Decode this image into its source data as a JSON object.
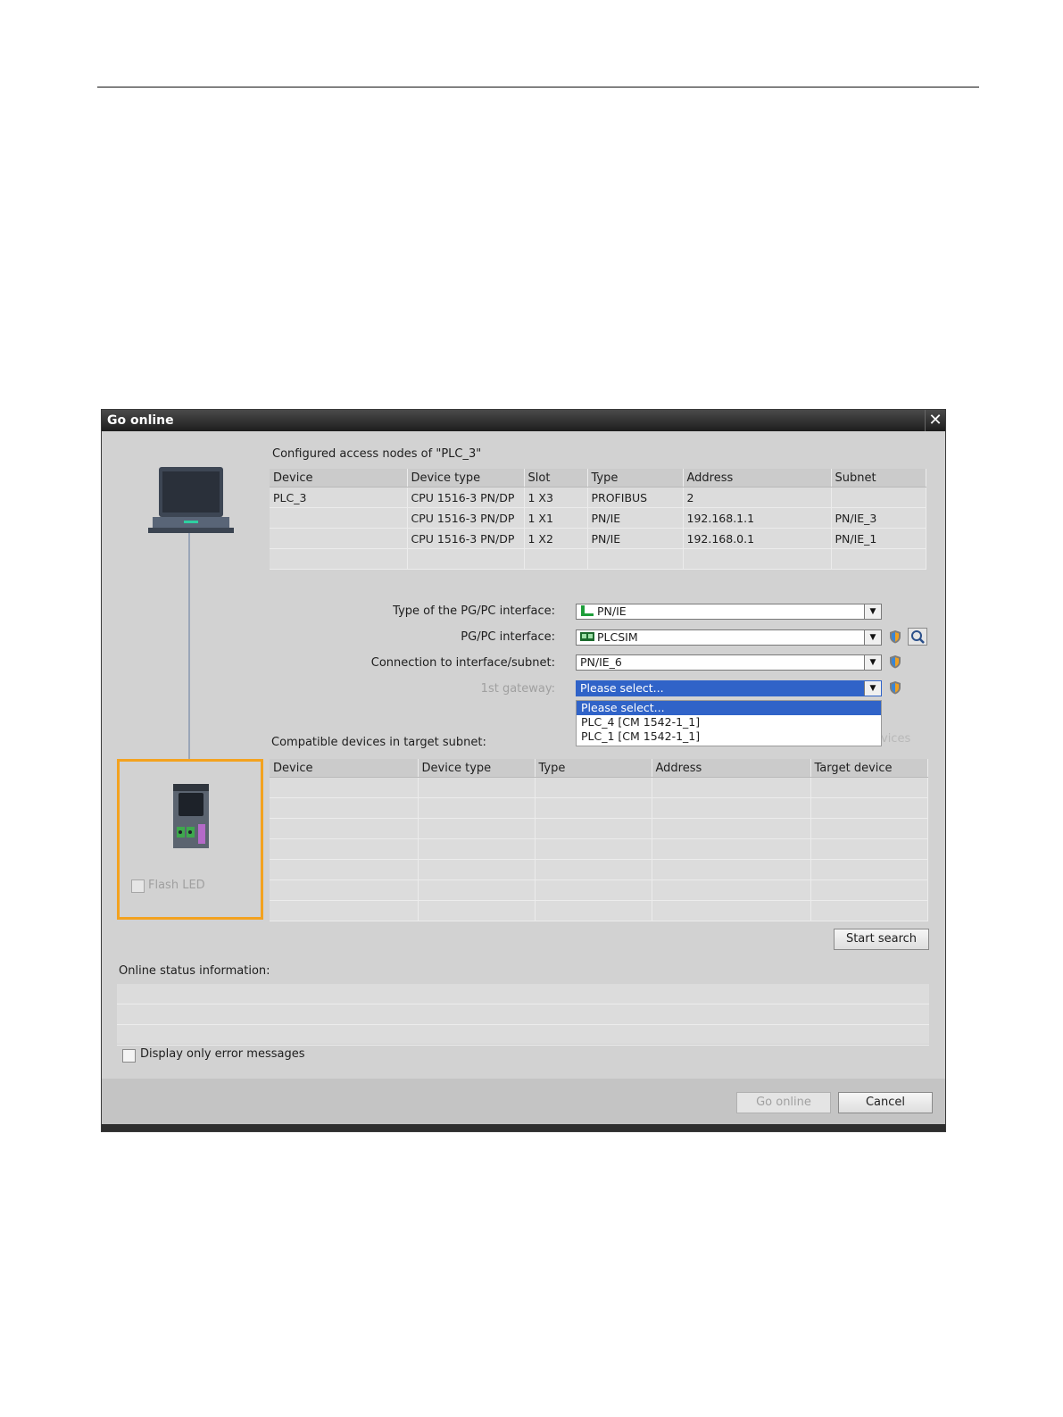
{
  "dialog": {
    "title": "Go online",
    "close_glyph": "✕",
    "configured": {
      "heading": "Configured access nodes of \"PLC_3\"",
      "columns": [
        "Device",
        "Device type",
        "Slot",
        "Type",
        "Address",
        "Subnet"
      ],
      "rows": [
        [
          "PLC_3",
          "CPU 1516-3 PN/DP",
          "1 X3",
          "PROFIBUS",
          "2",
          ""
        ],
        [
          "",
          "CPU 1516-3 PN/DP",
          "1 X1",
          "PN/IE",
          "192.168.1.1",
          "PN/IE_3"
        ],
        [
          "",
          "CPU 1516-3 PN/DP",
          "1 X2",
          "PN/IE",
          "192.168.0.1",
          "PN/IE_1"
        ],
        [
          "",
          "",
          "",
          "",
          "",
          ""
        ]
      ]
    },
    "settings": {
      "pgpc_type_label": "Type of the PG/PC interface:",
      "pgpc_type_value": "PN/IE",
      "pgpc_interface_label": "PG/PC interface:",
      "pgpc_interface_value": "PLCSIM",
      "connection_label": "Connection to interface/subnet:",
      "connection_value": "PN/IE_6",
      "gateway_label": "1st gateway:",
      "gateway_value": "Please select...",
      "gateway_options": [
        "Please select...",
        "PLC_4 [CM 1542-1_1]",
        "PLC_1 [CM 1542-1_1]"
      ]
    },
    "compatible": {
      "heading": "Compatible devices in target subnet:",
      "hidden_suffix": "vices",
      "columns": [
        "Device",
        "Device type",
        "Type",
        "Address",
        "Target device"
      ]
    },
    "flash_led_label": "Flash LED",
    "start_search_label": "Start search",
    "online_status_label": "Online status information:",
    "error_only_label": "Display only error messages",
    "go_online_label": "Go online",
    "cancel_label": "Cancel",
    "icons": {
      "laptop": "laptop-icon",
      "plc": "plc-device-icon",
      "shield": "shield-icon",
      "search": "search-icon"
    },
    "colors": {
      "selection": "#3063c8",
      "highlight_border": "#f3a21f",
      "dialog_bg": "#d2d2d2"
    }
  }
}
